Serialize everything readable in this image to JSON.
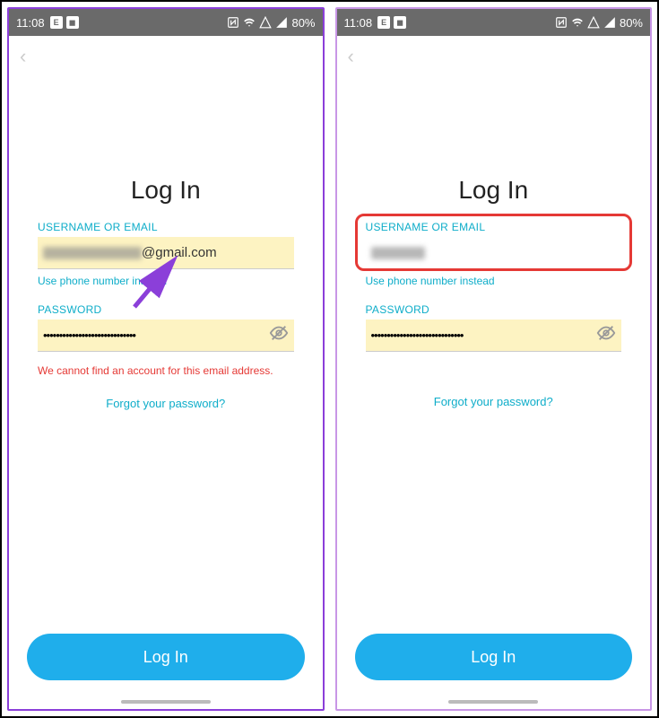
{
  "statusbar": {
    "time": "11:08",
    "app_icon_1": "E",
    "app_icon_2": "◼",
    "battery": "80%"
  },
  "left": {
    "title": "Log In",
    "username_label": "USERNAME OR EMAIL",
    "username_value_suffix": "@gmail.com",
    "use_phone": "Use phone number instead",
    "password_label": "PASSWORD",
    "password_value": "•••••••••••••••••••••••••••••",
    "error": "We cannot find an account for this email address.",
    "forgot": "Forgot your password?",
    "login_btn": "Log In"
  },
  "right": {
    "title": "Log In",
    "username_label": "USERNAME OR EMAIL",
    "username_value": "",
    "use_phone": "Use phone number instead",
    "password_label": "PASSWORD",
    "password_value": "•••••••••••••••••••••••••••••",
    "forgot": "Forgot your password?",
    "login_btn": "Log In"
  }
}
